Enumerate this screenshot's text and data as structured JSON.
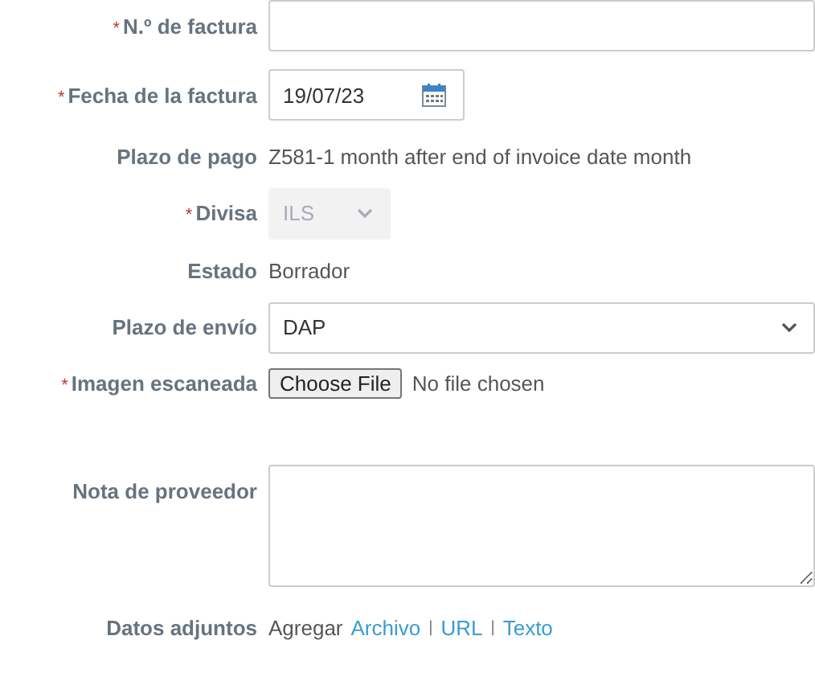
{
  "fields": [
    {
      "kind": "text",
      "required_mark": "*",
      "label": "N.º de factura"
    },
    {
      "kind": "date",
      "required_mark": "*",
      "label": "Fecha de la factura",
      "value": "19/07/23"
    },
    {
      "kind": "static",
      "label": "Plazo de pago",
      "value": "Z581-1 month after end of invoice date month"
    },
    {
      "kind": "select",
      "required_mark": "*",
      "label": "Divisa",
      "value": "ILS",
      "disabled": true
    },
    {
      "kind": "static",
      "label": "Estado",
      "value": "Borrador"
    },
    {
      "kind": "select",
      "label": "Plazo de envío",
      "value": "DAP",
      "disabled": false
    },
    {
      "kind": "file",
      "required_mark": "*",
      "label": "Imagen escaneada",
      "button": "Choose File",
      "status": "No file chosen"
    },
    {
      "kind": "textarea",
      "label": "Nota de proveedor"
    },
    {
      "kind": "links",
      "label": "Datos adjuntos",
      "prefix": "Agregar",
      "links": [
        "Archivo",
        "URL",
        "Texto"
      ],
      "separator": "|"
    }
  ]
}
